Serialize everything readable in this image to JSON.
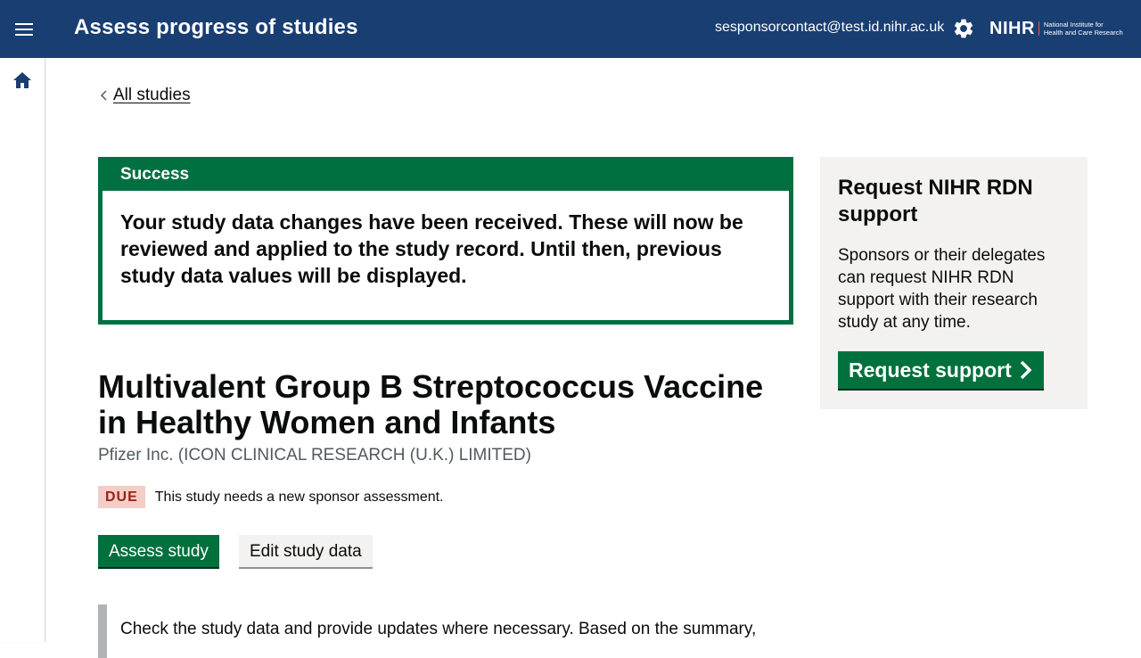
{
  "header": {
    "app_title": "Assess progress of studies",
    "user_email": "sesponsorcontact@test.id.nihr.ac.uk",
    "logo_mark": "NIHR",
    "logo_line1": "National Institute for",
    "logo_line2": "Health and Care Research"
  },
  "sidebar": {
    "home_icon": "home-icon"
  },
  "back_link": "All studies",
  "success": {
    "title": "Success",
    "message": "Your study data changes have been received. These will now be reviewed and applied to the study record. Until then, previous study data values will be displayed."
  },
  "study": {
    "title": "Multivalent Group B Streptococcus Vaccine in Healthy Women and Infants",
    "sponsor": "Pfizer Inc. (ICON CLINICAL RESEARCH (U.K.) LIMITED)",
    "status_badge": "DUE",
    "status_text": "This study needs a new sponsor assessment.",
    "assess_button": "Assess study",
    "edit_button": "Edit study data",
    "inset_text": "Check the study data and provide updates where necessary. Based on the summary,"
  },
  "support_panel": {
    "title": "Request NIHR RDN support",
    "text": "Sponsors or their delegates can request NIHR RDN support with their research study at any time.",
    "button": "Request support"
  },
  "colors": {
    "header_bg": "#193e72",
    "success_green": "#007041",
    "button_green": "#00703c",
    "badge_bg": "#f4cdc6",
    "badge_text": "#942514"
  }
}
